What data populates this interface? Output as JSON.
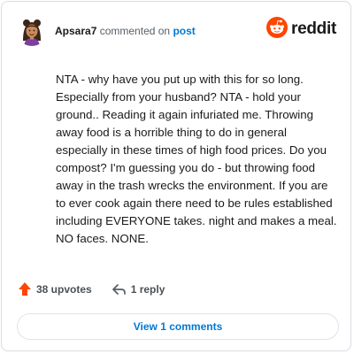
{
  "header": {
    "username": "Apsara7",
    "commented_on": "commented on",
    "post_link": "post",
    "brand": "reddit",
    "avatar_icon": "user-avatar-icon",
    "brand_icon": "reddit-snoo-icon"
  },
  "comment": {
    "body": "NTA - why have you put up with this for so long. Especially from your husband? NTA - hold your ground.. Reading it again infuriated me. Throwing away food is a horrible thing to do in general especially in these times of high food prices. Do you compost? I'm guessing you do - but throwing food away in the trash wrecks the environment. If you are to ever cook again there need to be rules established including EVERYONE takes. night and makes a meal. NO faces. NONE."
  },
  "actions": {
    "upvotes": "38 upvotes",
    "replies": "1 reply",
    "upvote_icon": "upvote-arrow-icon",
    "reply_icon": "reply-arrow-icon"
  },
  "footer": {
    "view_comments": "View 1 comments"
  },
  "colors": {
    "upvote": "#ff4500",
    "link": "#0079d3",
    "brand": "#ff4500",
    "text": "#1a1a1b"
  }
}
